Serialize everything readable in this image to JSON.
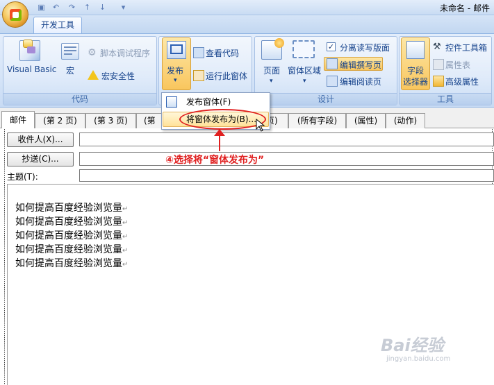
{
  "window": {
    "title": "未命名 - 邮件"
  },
  "ribbon": {
    "active_tab": "开发工具",
    "groups": {
      "code": {
        "label": "代码",
        "visual_basic": "Visual Basic",
        "macro": "宏",
        "script_debugger": "脚本调试程序",
        "macro_security": "宏安全性"
      },
      "publish": {
        "publish": "发布",
        "view_code": "查看代码",
        "run_form": "运行此窗体"
      },
      "design": {
        "label": "设计",
        "page": "页面",
        "form_region": "窗体区域",
        "separate_read_layout": "分离读写版面",
        "edit_compose": "编辑撰写页",
        "edit_read": "编辑阅读页"
      },
      "tools": {
        "label": "工具",
        "field_chooser": "字段\n选择器",
        "field_chooser_1": "字段",
        "field_chooser_2": "选择器",
        "control_toolbox": "控件工具箱",
        "property_sheet": "属性表",
        "advanced_properties": "高级属性"
      }
    }
  },
  "menu": {
    "publish_form": "发布窗体(F)",
    "publish_form_as": "将窗体发布为(B)..."
  },
  "form_tabs": [
    "邮件",
    "(第 2 页)",
    "(第 3 页)",
    "(第 4",
    "页)",
    "(所有字段)",
    "(属性)",
    "(动作)"
  ],
  "fields": {
    "to_button": "收件人(X)...",
    "cc_button": "抄送(C)...",
    "subject_label": "主题(T):"
  },
  "body_lines": [
    "如何提高百度经验浏览量",
    "如何提高百度经验浏览量",
    "如何提高百度经验浏览量",
    "如何提高百度经验浏览量",
    "如何提高百度经验浏览量"
  ],
  "annotation": "④选择将“窗体发布为”",
  "watermark": {
    "brand": "Bai经验",
    "url": "jingyan.baidu.com"
  },
  "colors": {
    "annotation": "#e02020",
    "ribbon_text": "#15428b"
  }
}
